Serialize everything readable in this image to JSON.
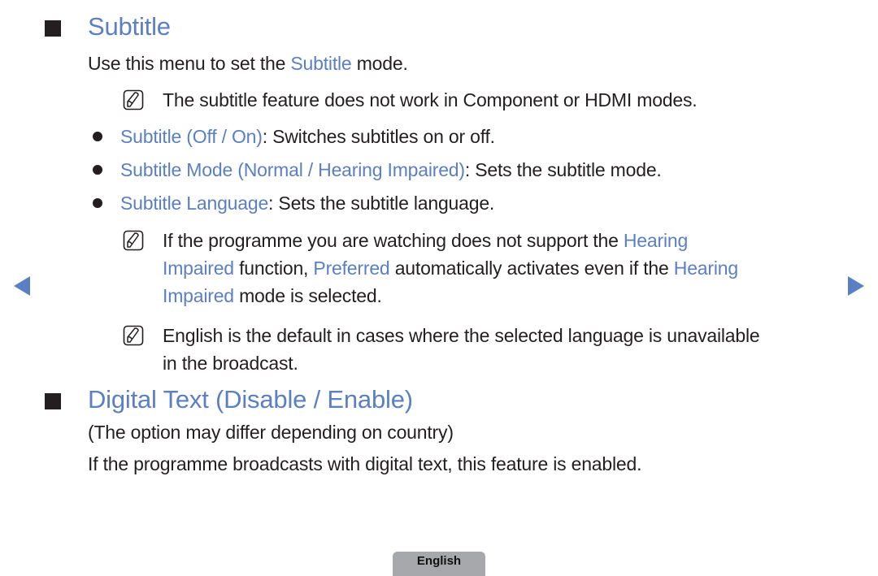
{
  "section1": {
    "heading": "Subtitle",
    "intro": {
      "before": "Use this menu to set the ",
      "highlight": "Subtitle",
      "after": " mode."
    },
    "note1": "The subtitle feature does not work in Component or HDMI modes.",
    "bullets": [
      {
        "label": "Subtitle (Off / On)",
        "desc": ": Switches subtitles on or off."
      },
      {
        "label": "Subtitle Mode (Normal / Hearing Impaired)",
        "desc": ": Sets the subtitle mode."
      },
      {
        "label": "Subtitle Language",
        "desc": ": Sets the subtitle language."
      }
    ],
    "note2": {
      "line1_text": "If the programme you are watching does not support the ",
      "line1_hl": "Hearing",
      "line2_hl1": "Impaired",
      "line2_text1": " function, ",
      "line2_hl2": "Preferred",
      "line2_text2": " automatically activates even if the ",
      "line2_hl3": "Hearing",
      "line3_hl": "Impaired",
      "line3_text": " mode is selected."
    },
    "note3": {
      "line1": "English is the default in cases where the selected language is unavailable",
      "line2": "in the broadcast."
    }
  },
  "section2": {
    "heading": "Digital Text (Disable / Enable)",
    "para1": "(The option may differ depending on country)",
    "para2": "If the programme broadcasts with digital text, this feature is enabled."
  },
  "navigation": {
    "prev_icon": "triangle-left",
    "next_icon": "triangle-right",
    "accent_color": "#5b7fc3"
  },
  "footer": {
    "language_tab": "English"
  }
}
